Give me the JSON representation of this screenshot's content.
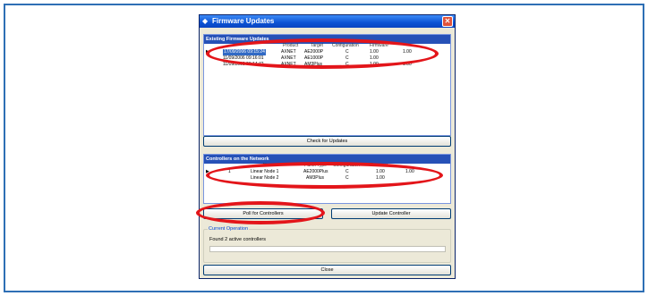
{
  "window": {
    "title": "Firmware Updates"
  },
  "firmware": {
    "header": "Existing Firmware Updates",
    "columns": [
      "Product",
      "Target",
      "Configuration",
      "Firmware"
    ],
    "rows": [
      {
        "date": "17/09/2006 09:15:24",
        "product": "AXNET",
        "target": "AE2000P",
        "config": "C",
        "fw1": "1.00",
        "fw2": "1.00"
      },
      {
        "date": "11/09/2006 09:16:01",
        "product": "AXNET",
        "target": "AE1000P",
        "config": "C",
        "fw1": "1.00",
        "fw2": ""
      },
      {
        "date": "11/09/2006 09:14:42",
        "product": "AXNET",
        "target": "AM3Plus",
        "config": "C",
        "fw1": "1.00",
        "fw2": "1.00"
      }
    ]
  },
  "check_button": "Check for Updates",
  "controllers": {
    "header": "Controllers on the Network",
    "columns": [
      "Name",
      "Panel Type",
      "Configuration",
      "Firmware"
    ],
    "rows": [
      {
        "id": "1",
        "name": "Linear Node 1",
        "panel": "AE2000Plus",
        "config": "C",
        "fw1": "1.00",
        "fw2": "1.00"
      },
      {
        "id": "",
        "name": "Linear Node 2",
        "panel": "AM3Plus",
        "config": "C",
        "fw1": "1.00",
        "fw2": ""
      }
    ]
  },
  "poll_button": "Poll for Controllers",
  "update_button": "Update Controller",
  "current_operation": {
    "legend": "Current Operation",
    "text": "Found 2 active controllers",
    "progress": 0
  },
  "close_button": "Close",
  "colors": {
    "highlight": "#e3151a",
    "frame": "#2e6fb5",
    "selection": "#316ac5"
  }
}
